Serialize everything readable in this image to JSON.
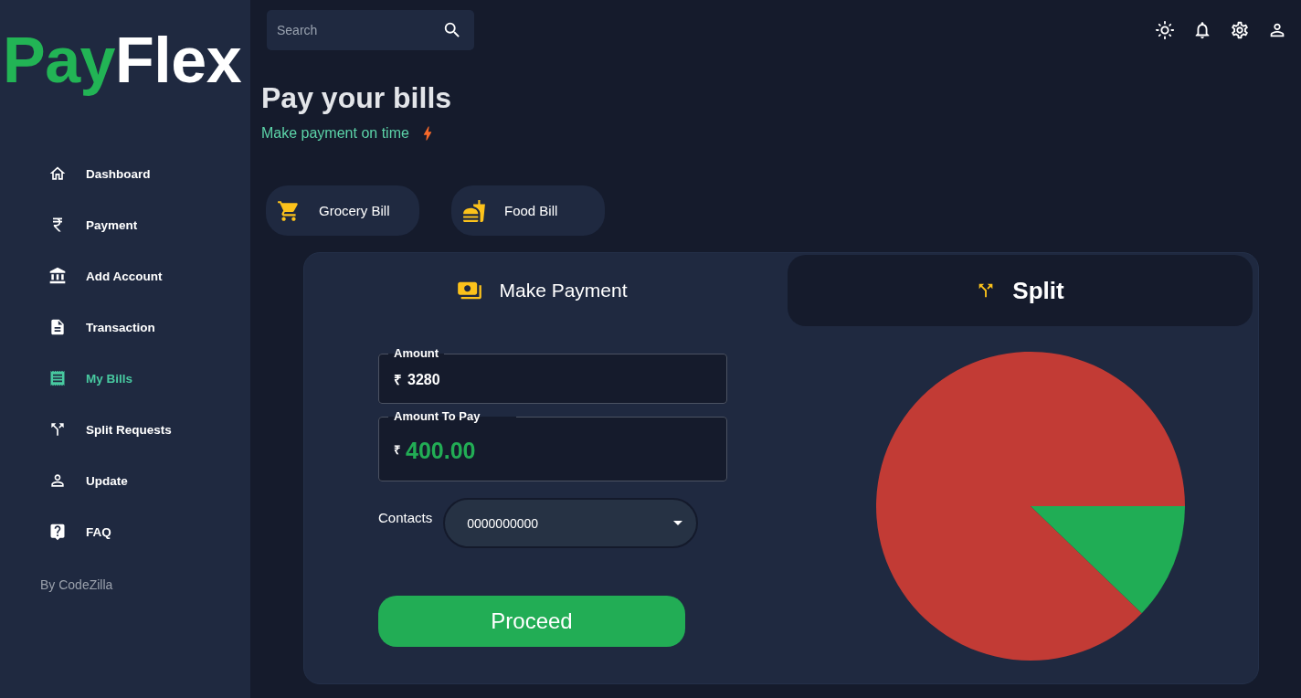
{
  "logo": {
    "accent": "Pay",
    "rest": "Flex"
  },
  "sidebar": {
    "items": [
      {
        "label": "Dashboard",
        "selected": false
      },
      {
        "label": "Payment",
        "selected": false
      },
      {
        "label": "Add Account",
        "selected": false
      },
      {
        "label": "Transaction",
        "selected": false
      },
      {
        "label": "My Bills",
        "selected": true
      },
      {
        "label": "Split Requests",
        "selected": false
      },
      {
        "label": "Update",
        "selected": false
      },
      {
        "label": "FAQ",
        "selected": false
      }
    ],
    "footer": "By CodeZilla"
  },
  "search": {
    "placeholder": "Search"
  },
  "header": {
    "title": "Pay your bills",
    "subtitle": "Make payment on time"
  },
  "bills": [
    {
      "label": "Grocery Bill"
    },
    {
      "label": "Food Bill"
    }
  ],
  "tabs": [
    {
      "label": "Make Payment",
      "selected": false
    },
    {
      "label": "Split",
      "selected": true
    }
  ],
  "form": {
    "fields": [
      {
        "kind": "plain",
        "label": "Amount",
        "currency": "₹",
        "value": "3280"
      },
      {
        "kind": "highlight",
        "label": "Amount To Pay",
        "currency": "₹",
        "value": "400.00"
      }
    ],
    "contacts": {
      "label": "Contacts",
      "value": "0000000000"
    },
    "button": "Proceed"
  },
  "split": {
    "chart_data": {
      "type": "pie",
      "values": [
        87.8,
        12.2
      ],
      "colors": [
        "#c23b35",
        "#20ad55"
      ]
    }
  }
}
